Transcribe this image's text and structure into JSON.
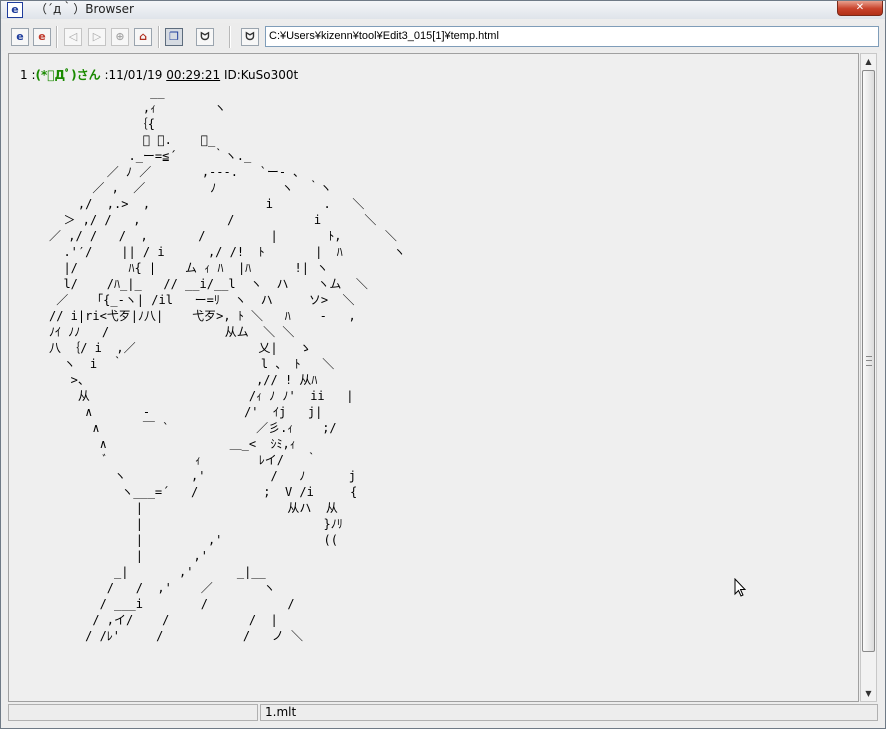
{
  "window": {
    "title": "（´д｀）Browser",
    "app_icon": "e",
    "close_glyph": "✕"
  },
  "toolbar": {
    "buttons": [
      {
        "name": "browser-icon",
        "glyph": "e"
      },
      {
        "name": "browser-red-icon",
        "glyph": "e"
      },
      {
        "name": "back-icon",
        "glyph": "◁"
      },
      {
        "name": "forward-icon",
        "glyph": "▷"
      },
      {
        "name": "stop-icon",
        "glyph": "⊕"
      },
      {
        "name": "home-icon",
        "glyph": "⌂"
      },
      {
        "name": "copy-icon",
        "glyph": "❐"
      },
      {
        "name": "face-icon",
        "glyph": "ᗢ"
      },
      {
        "name": "face-alt-icon",
        "glyph": "ᗢ"
      }
    ],
    "address": "C:¥Users¥kizenn¥tool¥Edit3_015[1]¥temp.html"
  },
  "post": {
    "number": "1",
    "separator": " :",
    "name": "(*ﾟДﾟ)さん",
    "date": " :11/01/19 ",
    "time": "00:29:21",
    "id": " ID:KuSo300t"
  },
  "art": "              __\n             ,ｨ        ヽ\n            ｛{\n             ﾞ ､.    ＿_\n           ._ー=≦´     ｀ヽ._\n        ／ ﾉ ／       ,---.   `ー- ､\n      ／ ,  ／         ﾉ         ヽ  ｀ヽ\n    ,/  ,.>  ,                i       .   ＼\n  ＞ ,/ /   ,            /           i      ＼\n／ ,/ /   /  ,       /         |       ﾄ,      ＼\n  .'′/    || / i      ,/ /!  ﾄ       |  ﾊ       ヽ\n  |/       ﾊ{ |    ム ｨ ﾊ  |ﾊ      !| ヽ\n  l/    /ﾊ_|_   // __i/__l  ヽ  ハ    ヽム  ＼\n ／    ｢{_-ヽ| /il   ー=ﾘ  ヽ  ハ     ソ>  ＼\n// i|ri<弋歹|ﾉ八|    弋歹>, ﾄ ＼   ﾊ    -   ,\nﾉｲ ﾉﾉ   /                从ム  ＼ ＼\n八 ｛/ i  ,／                 乂|   ゝ\n  ヽ  i  ｀                   l 、 ﾄ   ＼\n   >、                       ,// ! 从ﾊ\n    从                      /ｨ ﾉ ﾉ'  ii   |\n     ∧       -             /'  ｲj   j|\n      ∧      ￣ `            ／彡.ｨ    ;/\n       ∧                 ＿_<  ｼﾐ,ｨ\n        ﾞ            ｨ        ﾚイ/   ｀\n         ヽ         ,'         /   ﾉ      j\n          ヽ___=´   /         ;  V /i     {\n            |                    从ハ  从\n            |                         }ﾉﾘ\n            |         ,'              ((\n            |       ,'\n         _|       ,'      _|__\n        /   /  ,'    ／       ヽ\n       / ___i        /           /\n      / ,イ/    /           /  |\n     / /ﾚ'     /           /   ノ ＼",
  "status": {
    "left": "",
    "file": "1.mlt",
    "right": ""
  }
}
